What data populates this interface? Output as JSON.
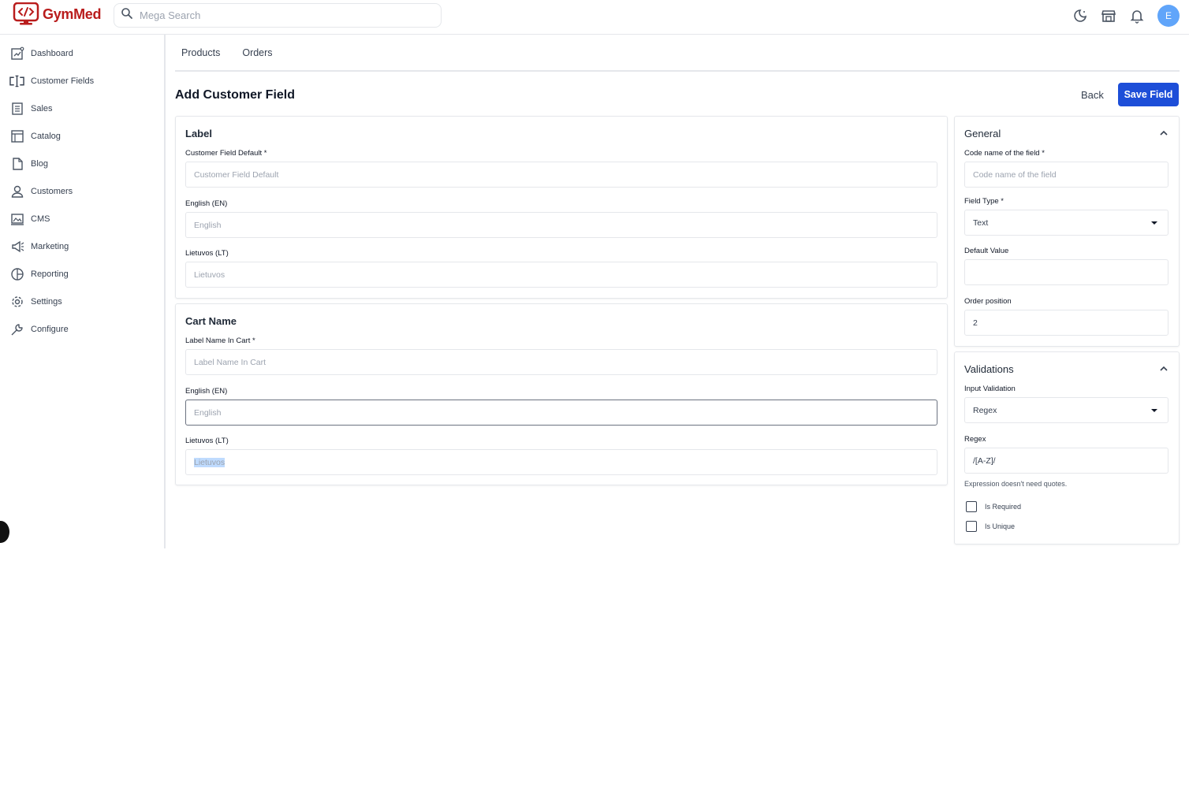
{
  "brand": {
    "name": "GymMed",
    "color": "#b91c1c"
  },
  "search": {
    "placeholder": "Mega Search"
  },
  "header": {
    "avatar_initial": "E"
  },
  "sidebar": {
    "items": [
      {
        "label": "Dashboard",
        "icon": "dashboard-icon"
      },
      {
        "label": "Customer Fields",
        "icon": "customer-fields-icon"
      },
      {
        "label": "Sales",
        "icon": "sales-icon"
      },
      {
        "label": "Catalog",
        "icon": "catalog-icon"
      },
      {
        "label": "Blog",
        "icon": "blog-icon"
      },
      {
        "label": "Customers",
        "icon": "customers-icon"
      },
      {
        "label": "CMS",
        "icon": "cms-icon"
      },
      {
        "label": "Marketing",
        "icon": "marketing-icon"
      },
      {
        "label": "Reporting",
        "icon": "reporting-icon"
      },
      {
        "label": "Settings",
        "icon": "settings-icon"
      },
      {
        "label": "Configure",
        "icon": "configure-icon"
      }
    ]
  },
  "tabs": [
    {
      "label": "Products"
    },
    {
      "label": "Orders"
    }
  ],
  "page": {
    "title": "Add Customer Field",
    "back_label": "Back",
    "save_label": "Save Field"
  },
  "label_card": {
    "title": "Label",
    "fields": [
      {
        "label": "Customer Field Default *",
        "placeholder": "Customer Field Default",
        "value": ""
      },
      {
        "label": "English (EN)",
        "placeholder": "English",
        "value": ""
      },
      {
        "label": "Lietuvos (LT)",
        "placeholder": "Lietuvos",
        "value": ""
      }
    ]
  },
  "cart_card": {
    "title": "Cart Name",
    "fields": [
      {
        "label": "Label Name In Cart *",
        "placeholder": "Label Name In Cart",
        "value": ""
      },
      {
        "label": "English (EN)",
        "placeholder": "English",
        "value": ""
      },
      {
        "label": "Lietuvos (LT)",
        "placeholder": "",
        "value": "Lietuvos"
      }
    ]
  },
  "general_card": {
    "title": "General",
    "code_label": "Code name of the field *",
    "code_placeholder": "Code name of the field",
    "type_label": "Field Type *",
    "type_value": "Text",
    "default_label": "Default Value",
    "default_value": "",
    "order_label": "Order position",
    "order_value": "2"
  },
  "validations_card": {
    "title": "Validations",
    "input_validation_label": "Input Validation",
    "input_validation_value": "Regex",
    "regex_label": "Regex",
    "regex_value": "/[A-Z]/",
    "hint": "Expression doesn't need quotes.",
    "required_label": "Is Required",
    "unique_label": "Is Unique"
  },
  "colors": {
    "primary": "#1d4ed8",
    "avatar": "#60a5fa"
  }
}
